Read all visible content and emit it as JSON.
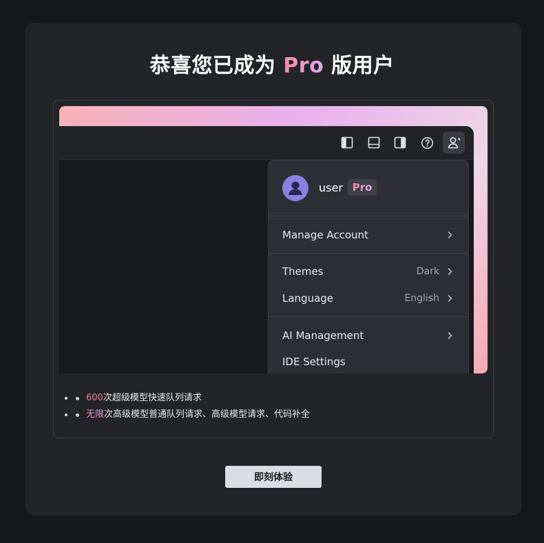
{
  "dialog": {
    "title_prefix": "恭喜您已成为",
    "title_highlight": "Pro",
    "title_suffix": "版用户"
  },
  "toolbar": {
    "icons": [
      "layout-left-panel-icon",
      "layout-bottom-panel-icon",
      "layout-right-panel-icon",
      "help-circle-icon",
      "user-account-icon"
    ]
  },
  "account_menu": {
    "username": "user",
    "badge": "Pro",
    "items": [
      {
        "label": "Manage Account",
        "value": ""
      },
      {
        "label": "Themes",
        "value": "Dark"
      },
      {
        "label": "Language",
        "value": "English"
      },
      {
        "label": "AI Management",
        "value": ""
      },
      {
        "label": "IDE Settings",
        "value": ""
      }
    ]
  },
  "features": [
    {
      "highlight": "600",
      "text": "次超级模型快速队列请求"
    },
    {
      "highlight": "无限",
      "text": "次高级模型普通队列请求、高级模型请求、代码补全"
    }
  ],
  "cta": {
    "label": "即刻体验"
  },
  "colors": {
    "dialog_bg": "#232428",
    "accent_pink": "#f27c96",
    "accent_purple": "#e1a8f0",
    "button_bg": "#dcdde3"
  }
}
